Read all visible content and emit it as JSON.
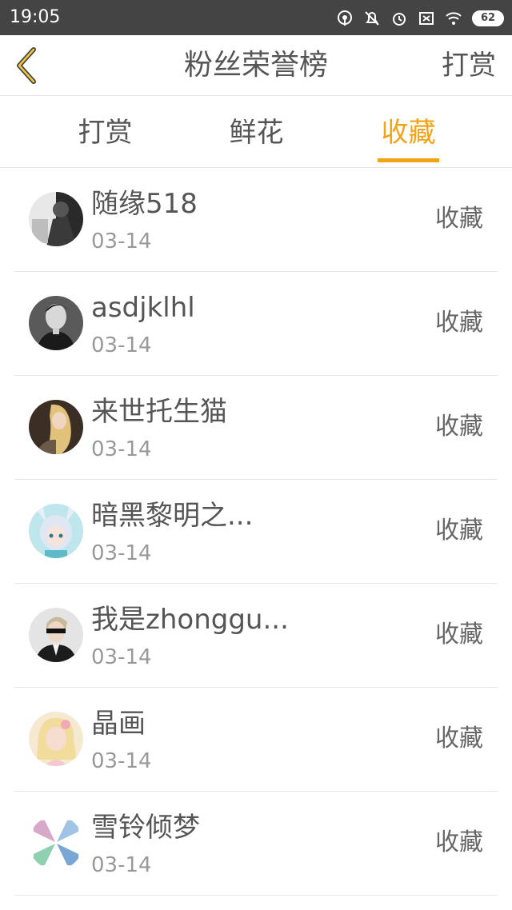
{
  "status_bar": {
    "time": "19:05",
    "battery": "62"
  },
  "nav": {
    "title": "粉丝荣誉榜",
    "action": "打赏"
  },
  "tabs": [
    "打赏",
    "鲜花",
    "收藏"
  ],
  "active_tab_color": "#f3a316",
  "rows": [
    {
      "name": "随缘518",
      "date": "03-14",
      "action": "收藏",
      "avatar": "avatar-bw-portrait"
    },
    {
      "name": "asdjklhl",
      "date": "03-14",
      "action": "收藏",
      "avatar": "avatar-bw-man"
    },
    {
      "name": "来世托生猫",
      "date": "03-14",
      "action": "收藏",
      "avatar": "avatar-blonde-woman"
    },
    {
      "name": "暗黑黎明之...",
      "date": "03-14",
      "action": "收藏",
      "avatar": "avatar-anime-girl"
    },
    {
      "name": "我是zhonggu...",
      "date": "03-14",
      "action": "收藏",
      "avatar": "avatar-man-sunglasses"
    },
    {
      "name": "晶画",
      "date": "03-14",
      "action": "收藏",
      "avatar": "avatar-girl-pink"
    },
    {
      "name": "雪铃倾梦",
      "date": "03-14",
      "action": "收藏",
      "avatar": "avatar-clover-collage"
    }
  ]
}
